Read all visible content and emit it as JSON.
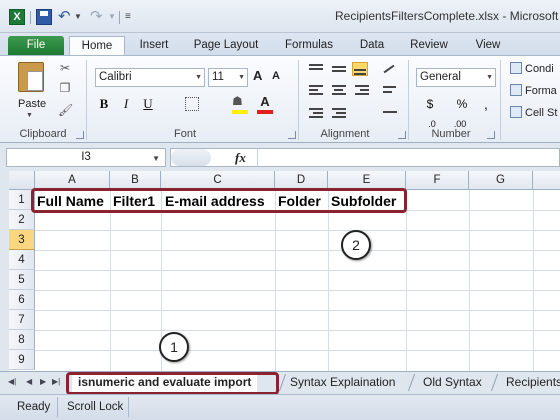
{
  "window": {
    "title": "RecipientsFiltersComplete.xlsx - Microsoft",
    "app_icon": "X"
  },
  "ribbon_tabs": [
    "File",
    "Home",
    "Insert",
    "Page Layout",
    "Formulas",
    "Data",
    "Review",
    "View"
  ],
  "ribbon": {
    "clipboard": {
      "paste_label": "Paste",
      "group_label": "Clipboard"
    },
    "font": {
      "name": "Calibri",
      "size": "11",
      "group_label": "Font",
      "bold": "B",
      "italic": "I",
      "underline": "U",
      "grow": "A",
      "shrink": "A",
      "font_color_glyph": "A",
      "highlight_color": "#ffef00",
      "font_color": "#e0201c"
    },
    "alignment": {
      "group_label": "Alignment"
    },
    "number": {
      "format": "General",
      "group_label": "Number",
      "currency": "$",
      "percent": "%",
      "comma": ",",
      "inc_decimal": ".0",
      "dec_decimal": ".00"
    },
    "styles": {
      "items": [
        "Condi",
        "Forma",
        "Cell St"
      ]
    }
  },
  "formula_bar": {
    "name_box": "I3",
    "fx": "fx",
    "value": ""
  },
  "grid": {
    "columns": [
      "A",
      "B",
      "C",
      "D",
      "E",
      "F",
      "G"
    ],
    "rows": [
      "1",
      "2",
      "3",
      "4",
      "5",
      "6",
      "7",
      "8",
      "9"
    ],
    "selected_row": "3",
    "row1_cells": [
      "Full Name",
      "Filter1",
      "E-mail address",
      "Folder",
      "Subfolder"
    ]
  },
  "callouts": [
    {
      "number": "1",
      "color": "#8b2230"
    },
    {
      "number": "2",
      "color": "#8b2230"
    }
  ],
  "sheet_tabs": [
    "isnumeric and evaluate import",
    "Syntax Explaination",
    "Old Syntax",
    "Recipients"
  ],
  "active_sheet": "isnumeric and evaluate import",
  "status_bar": [
    "Ready",
    "Scroll Lock"
  ]
}
